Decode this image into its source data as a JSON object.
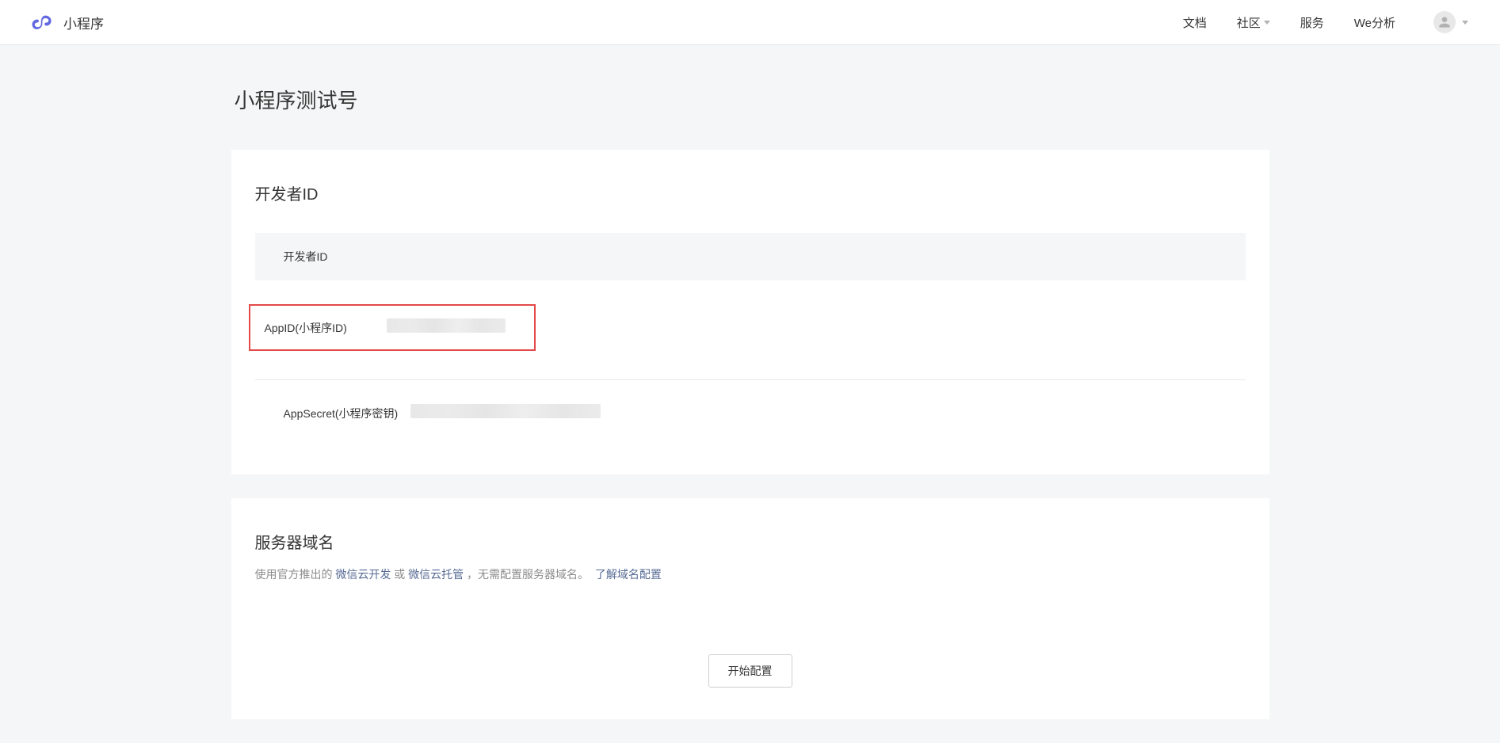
{
  "header": {
    "logo_text": "小程序",
    "nav": {
      "docs": "文档",
      "community": "社区",
      "service": "服务",
      "weanalytics": "We分析"
    }
  },
  "page": {
    "title": "小程序测试号"
  },
  "developer_id_card": {
    "title": "开发者ID",
    "table_header": "开发者ID",
    "rows": {
      "appid_label": "AppID(小程序ID)",
      "appsecret_label": "AppSecret(小程序密钥)"
    }
  },
  "server_domain_card": {
    "title": "服务器域名",
    "desc_prefix": "使用官方推出的 ",
    "link1": "微信云开发",
    "desc_or": " 或 ",
    "link2": "微信云托管",
    "desc_middle": " ，无需配置服务器域名。",
    "link3": "了解域名配置",
    "button": "开始配置"
  }
}
